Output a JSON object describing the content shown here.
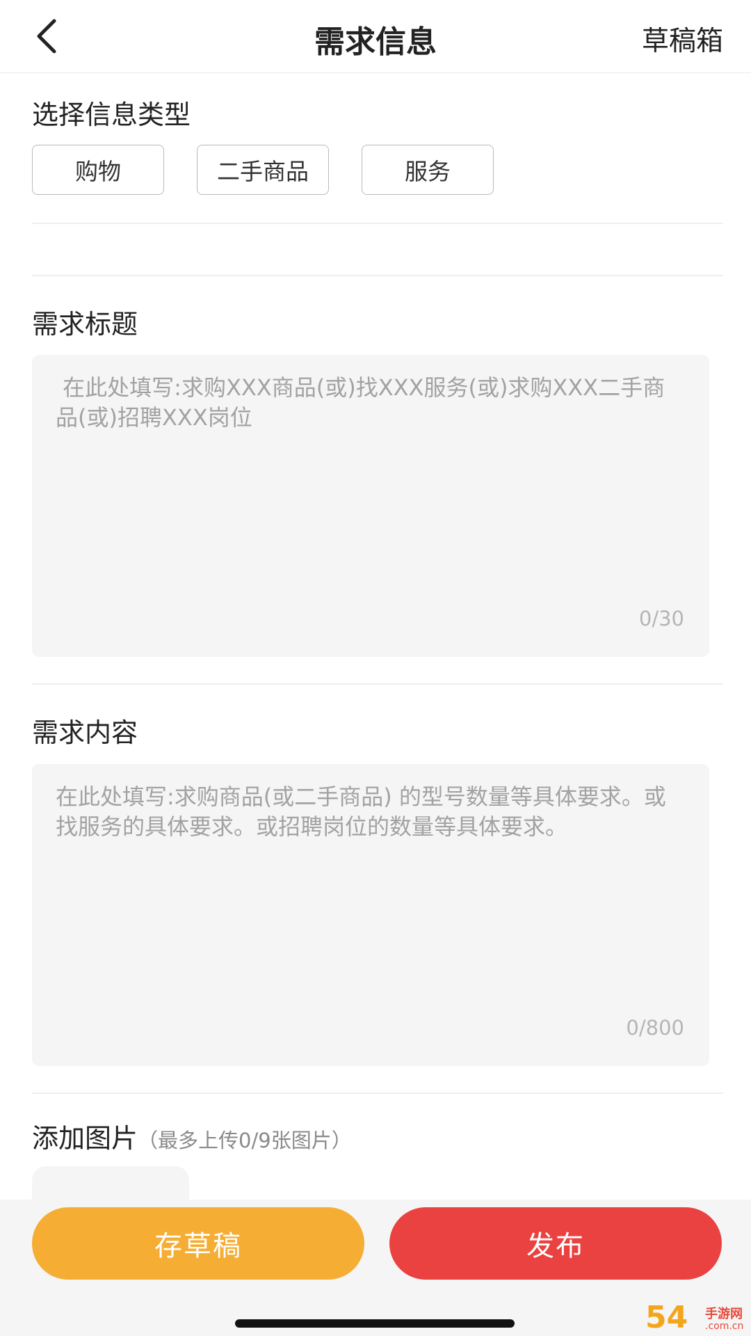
{
  "header": {
    "title": "需求信息",
    "drafts_label": "草稿箱",
    "back_icon": "chevron-left-icon"
  },
  "type_section": {
    "title": "选择信息类型",
    "options": [
      "购物",
      "二手商品",
      "服务"
    ]
  },
  "title_section": {
    "label": "需求标题",
    "placeholder": " 在此处填写:求购XXX商品(或)找XXX服务(或)求购XXX二手商品(或)招聘XXX岗位",
    "counter": "0/30"
  },
  "content_section": {
    "label": "需求内容",
    "placeholder": "在此处填写:求购商品(或二手商品) 的型号数量等具体要求。或找服务的具体要求。或招聘岗位的数量等具体要求。",
    "counter": "0/800"
  },
  "photo_section": {
    "label": "添加图片",
    "note": "（最多上传0/9张图片）"
  },
  "footer": {
    "save_draft_label": "存草稿",
    "publish_label": "发布"
  },
  "watermark": {
    "big": "54",
    "small": "手游网",
    "url": ".com.cn"
  },
  "colors": {
    "draft_button": "#f5ad33",
    "publish_button": "#ea4141",
    "field_background": "#f5f5f5"
  }
}
